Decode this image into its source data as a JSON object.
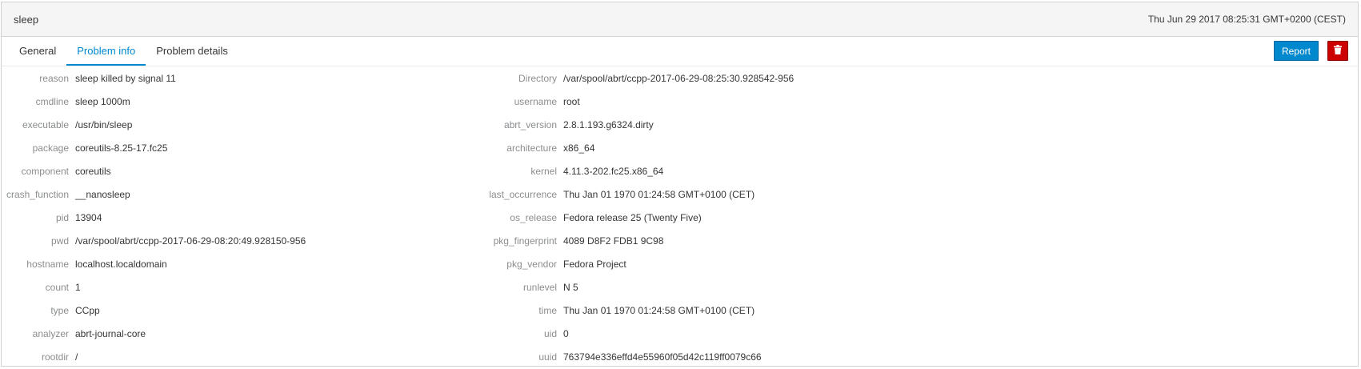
{
  "header": {
    "title": "sleep",
    "timestamp": "Thu Jun 29 2017 08:25:31 GMT+0200 (CEST)"
  },
  "tabs": [
    {
      "label": "General",
      "active": false
    },
    {
      "label": "Problem info",
      "active": true
    },
    {
      "label": "Problem details",
      "active": false
    }
  ],
  "actions": {
    "report_label": "Report",
    "delete_icon": "trash-icon"
  },
  "colors": {
    "accent": "#0088ce",
    "danger": "#cc0000"
  },
  "left_fields": [
    {
      "key": "reason",
      "value": "sleep killed by signal 11"
    },
    {
      "key": "cmdline",
      "value": "sleep 1000m"
    },
    {
      "key": "executable",
      "value": "/usr/bin/sleep"
    },
    {
      "key": "package",
      "value": "coreutils-8.25-17.fc25"
    },
    {
      "key": "component",
      "value": "coreutils"
    },
    {
      "key": "crash_function",
      "value": "__nanosleep"
    },
    {
      "key": "pid",
      "value": "13904"
    },
    {
      "key": "pwd",
      "value": "/var/spool/abrt/ccpp-2017-06-29-08:20:49.928150-956"
    },
    {
      "key": "hostname",
      "value": "localhost.localdomain"
    },
    {
      "key": "count",
      "value": "1"
    },
    {
      "key": "type",
      "value": "CCpp"
    },
    {
      "key": "analyzer",
      "value": "abrt-journal-core"
    },
    {
      "key": "rootdir",
      "value": "/"
    }
  ],
  "right_fields": [
    {
      "key": "Directory",
      "value": "/var/spool/abrt/ccpp-2017-06-29-08:25:30.928542-956"
    },
    {
      "key": "username",
      "value": "root"
    },
    {
      "key": "abrt_version",
      "value": "2.8.1.193.g6324.dirty"
    },
    {
      "key": "architecture",
      "value": "x86_64"
    },
    {
      "key": "kernel",
      "value": "4.11.3-202.fc25.x86_64"
    },
    {
      "key": "last_occurrence",
      "value": "Thu Jan 01 1970 01:24:58 GMT+0100 (CET)"
    },
    {
      "key": "os_release",
      "value": "Fedora release 25 (Twenty Five)"
    },
    {
      "key": "pkg_fingerprint",
      "value": "4089 D8F2 FDB1 9C98"
    },
    {
      "key": "pkg_vendor",
      "value": "Fedora Project"
    },
    {
      "key": "runlevel",
      "value": "N 5"
    },
    {
      "key": "time",
      "value": "Thu Jan 01 1970 01:24:58 GMT+0100 (CET)"
    },
    {
      "key": "uid",
      "value": "0"
    },
    {
      "key": "uuid",
      "value": "763794e336effd4e55960f05d42c119ff0079c66"
    }
  ]
}
